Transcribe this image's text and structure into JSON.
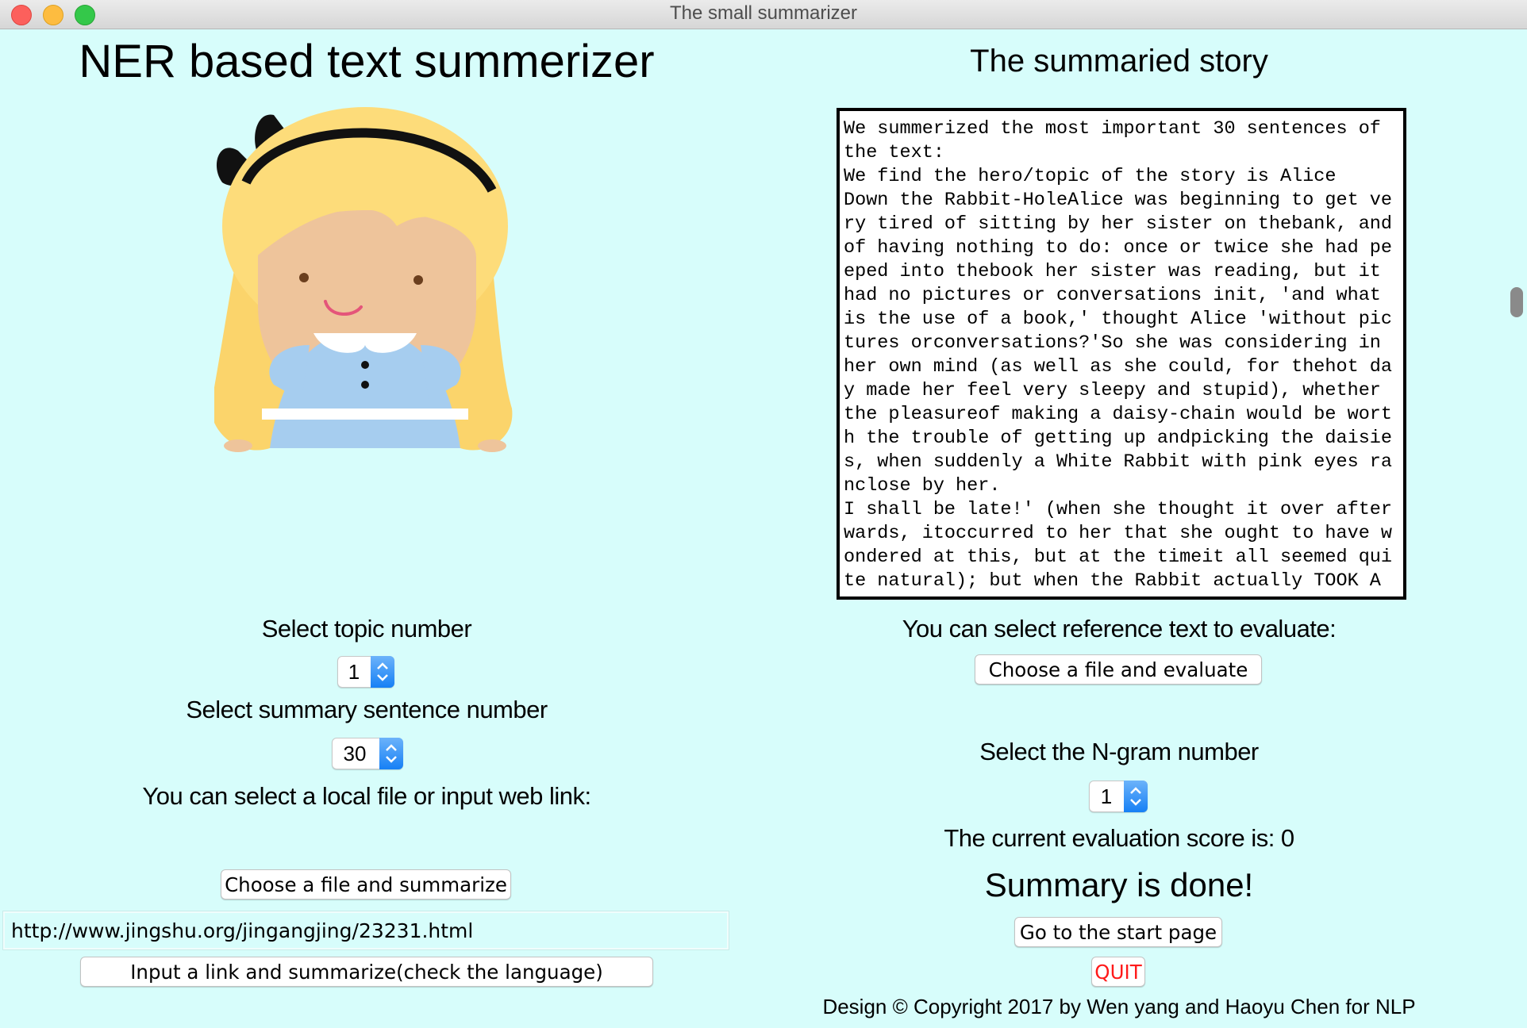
{
  "window": {
    "title": "The small summarizer"
  },
  "left": {
    "heading": "NER based text summerizer",
    "topic_label": "Select topic number",
    "topic_value": "1",
    "sentence_label": "Select summary sentence number",
    "sentence_value": "30",
    "source_label": "You can select a local file or input web link:",
    "choose_file_button": "Choose a file and summarize",
    "url_value": "http://www.jingshu.org/jingangjing/23231.html",
    "link_button": "Input a link and summarize(check the language)"
  },
  "right": {
    "heading": "The summaried story",
    "summary_text": "We summerized the most important 30 sentences of the text:\nWe find the hero/topic of the story is Alice\nDown the Rabbit-HoleAlice was beginning to get very tired of sitting by her sister on thebank, and of having nothing to do: once or twice she had peeped into thebook her sister was reading, but it had no pictures or conversations init, 'and what is the use of a book,' thought Alice 'without pictures orconversations?'So she was considering in her own mind (as well as she could, for thehot day made her feel very sleepy and stupid), whether the pleasureof making a daisy-chain would be worth the trouble of getting up andpicking the daisies, when suddenly a White Rabbit with pink eyes ranclose by her.\nI shall be late!' (when she thought it over afterwards, itoccurred to her that she ought to have wondered at this, but at the timeit all seemed quite natural); but when the Rabbit actually TOOK A WATCH",
    "reference_label": "You can select reference text to evaluate:",
    "evaluate_button": "Choose a file and evaluate",
    "ngram_label": "Select the N-gram number",
    "ngram_value": "1",
    "score_text": "The current evaluation score is: 0",
    "status_text": "Summary is done!",
    "start_button": "Go to the start page",
    "quit_button": "QUIT",
    "copyright": "Design © Copyright 2017 by Wen yang and Haoyu Chen for NLP"
  },
  "colors": {
    "background": "#d7fdfb",
    "quit_text": "#ff1a1a",
    "stepper_accent": "#1680f5"
  },
  "icons": [
    "alice-illustration",
    "stepper-arrows-icon"
  ]
}
